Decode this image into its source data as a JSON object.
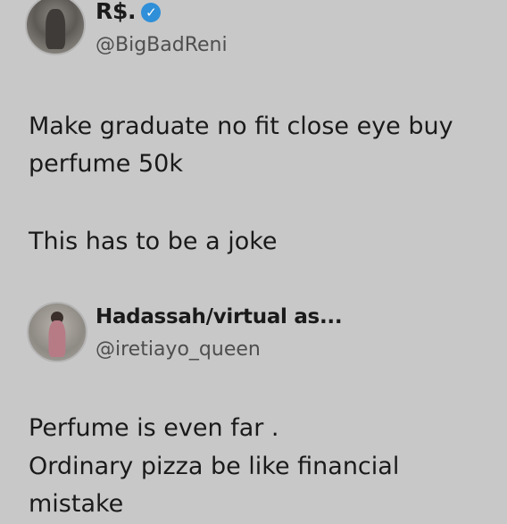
{
  "tweet1": {
    "display_name": "R$.",
    "handle": "@BigBadReni",
    "verified_icon": "verified-badge-icon",
    "lines": [
      "Make graduate no fit close eye buy",
      "perfume 50k"
    ],
    "line3": "This has to be a joke"
  },
  "tweet2": {
    "display_name": "Hadassah/virtual as...",
    "handle": "@iretiayo_queen",
    "lines": [
      "Perfume is even far .",
      "Ordinary pizza be like financial",
      "mistake"
    ]
  },
  "colors": {
    "background": "#c8c8c8",
    "verified": "#2f8fd8",
    "handle": "#4e4e4e"
  }
}
